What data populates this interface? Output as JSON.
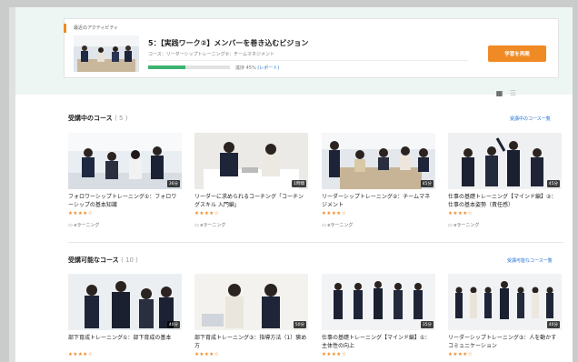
{
  "activity": {
    "section_label": "最近のアクティビティ",
    "title": "5：【実践ワーク②】メンバーを巻き込むビジョン",
    "course_line": "コース：リーダーシップトレーニング②：チームマネジメント",
    "progress": 0.45,
    "progress_text": "進捗 45%",
    "report_link": "(レポート)",
    "resume_label": "学習を再開"
  },
  "view_toggle": {
    "grid_icon": "grid-icon",
    "list_icon": "list-icon"
  },
  "in_progress": {
    "title": "受講中のコース",
    "count": "( 5 )",
    "link": "受講中のコース一覧",
    "cards": [
      {
        "name": "フォロワーシップトレーニング①：フォロワーシップの基本知識",
        "duration": "36分",
        "stars": "★★★★☆",
        "type": "eラーニング"
      },
      {
        "name": "リーダーに求められるコーチング「コーチングスキル 入門編」",
        "duration": "1時間",
        "stars": "★★★★☆",
        "type": "eラーニング"
      },
      {
        "name": "リーダーシップトレーニング②：チームマネジメント",
        "duration": "45分",
        "stars": "★★★★☆",
        "type": "eラーニング"
      },
      {
        "name": "仕事の基礎トレーニング【マインド編】②：仕事の基本姿勢（責任感）",
        "duration": "45分",
        "stars": "★★★★☆",
        "type": "eラーニング"
      }
    ]
  },
  "available": {
    "title": "受講可能なコース",
    "count": "( 10 )",
    "link": "受講可能なコース一覧",
    "cards": [
      {
        "name": "部下育成トレーニング①：部下育成の基本",
        "duration": "40分",
        "stars": "★★★★☆"
      },
      {
        "name": "部下育成トレーニング③：指導方法（1）褒め方",
        "duration": "50分",
        "stars": "★★★★☆"
      },
      {
        "name": "仕事の基礎トレーニング【マインド編】①：主体性の向上",
        "duration": "35分",
        "stars": "★★★★☆"
      },
      {
        "name": "リーダーシップトレーニング③：人を動かすコミュニケーション",
        "duration": "40分",
        "stars": "★★★★☆"
      }
    ]
  }
}
